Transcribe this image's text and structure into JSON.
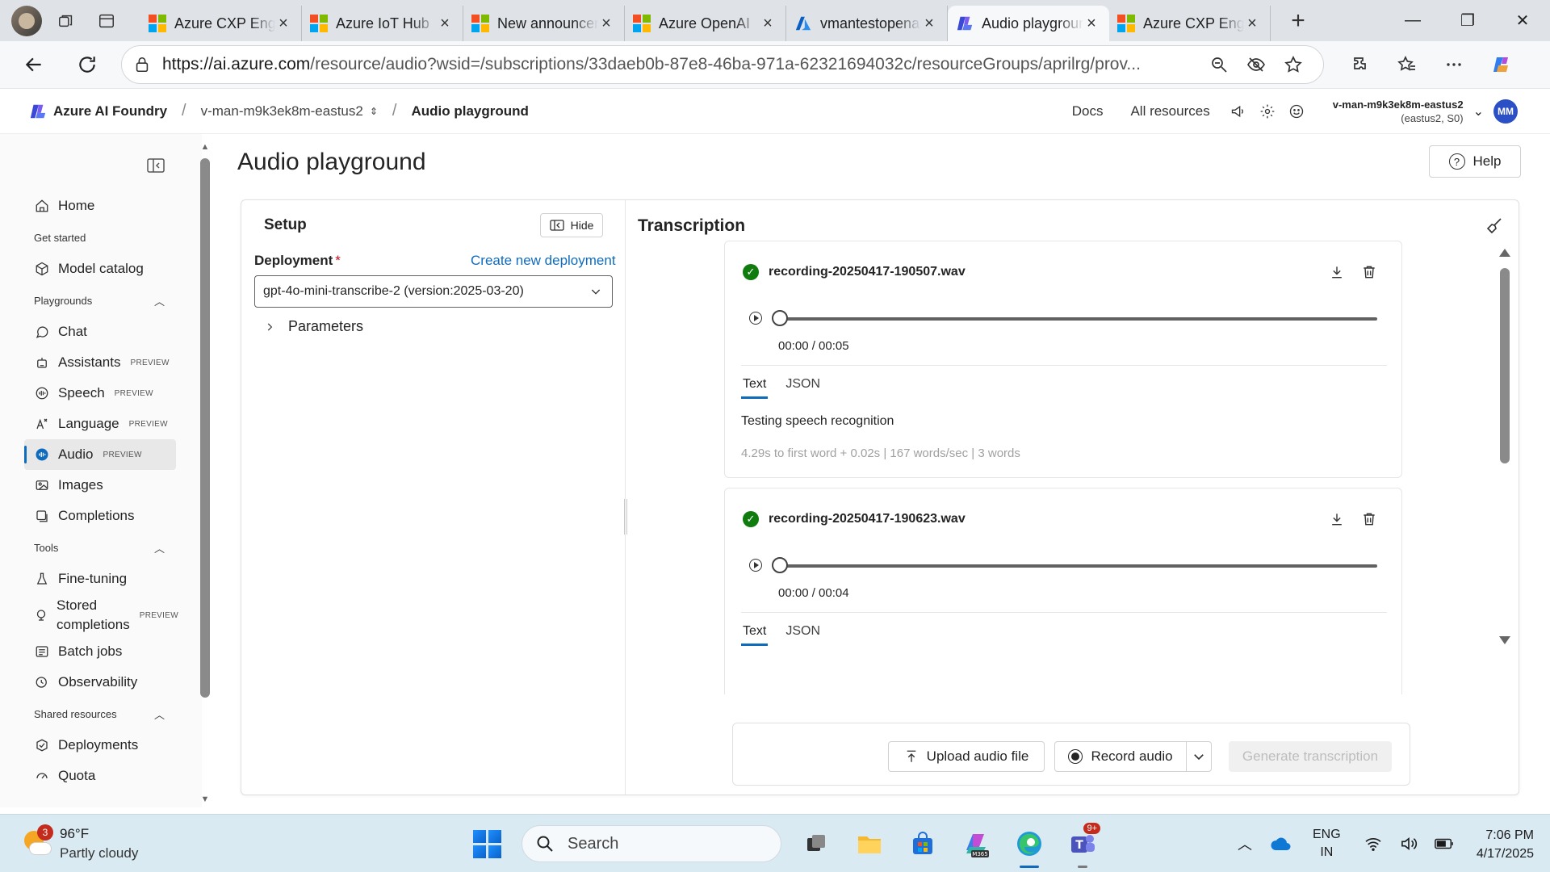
{
  "browser": {
    "tabs": [
      {
        "title": "Azure CXP Engagement",
        "favicon": "microsoft-logo"
      },
      {
        "title": "Azure IoT Hub",
        "favicon": "microsoft-logo"
      },
      {
        "title": "New announcement",
        "favicon": "microsoft-logo"
      },
      {
        "title": "Azure OpenAI",
        "favicon": "microsoft-logo"
      },
      {
        "title": "vmantestopenai",
        "favicon": "azure-logo"
      },
      {
        "title": "Audio playground",
        "favicon": "foundry-logo",
        "active": true
      },
      {
        "title": "Azure CXP Engagement",
        "favicon": "microsoft-logo"
      }
    ],
    "url_host": "https://ai.azure.com",
    "url_path": "/resource/audio?wsid=/subscriptions/33daeb0b-87e8-46ba-971a-62321694032c/resourceGroups/aprilrg/prov..."
  },
  "header": {
    "brand": "Azure AI Foundry",
    "project": "v-man-m9k3ek8m-eastus2",
    "page": "Audio playground",
    "docs": "Docs",
    "all_resources": "All resources",
    "account_name": "v-man-m9k3ek8m-eastus2",
    "account_sub": "(eastus2, S0)",
    "avatar": "MM"
  },
  "nav": {
    "home": "Home",
    "get_started": "Get started",
    "model_catalog": "Model catalog",
    "playgrounds": "Playgrounds",
    "chat": "Chat",
    "assistants": "Assistants",
    "speech": "Speech",
    "language": "Language",
    "audio": "Audio",
    "images": "Images",
    "completions": "Completions",
    "tools": "Tools",
    "fine_tuning": "Fine-tuning",
    "stored_completions": "Stored completions",
    "batch_jobs": "Batch jobs",
    "observability": "Observability",
    "shared_resources": "Shared resources",
    "deployments": "Deployments",
    "quota": "Quota",
    "preview": "PREVIEW"
  },
  "main": {
    "title": "Audio playground",
    "help": "Help",
    "setup": {
      "title": "Setup",
      "hide": "Hide",
      "deployment_label": "Deployment",
      "required_mark": "*",
      "create_link": "Create new deployment",
      "deployment_value": "gpt-4o-mini-transcribe-2 (version:2025-03-20)",
      "parameters": "Parameters"
    },
    "transcription": {
      "title": "Transcription",
      "tab_text": "Text",
      "tab_json": "JSON",
      "recordings": [
        {
          "file": "recording-20250417-190507.wav",
          "time": "00:00 / 00:05",
          "text": "Testing speech recognition",
          "stats": "4.29s to first word + 0.02s | 167 words/sec | 3 words"
        },
        {
          "file": "recording-20250417-190623.wav",
          "time": "00:00 / 00:04"
        }
      ]
    },
    "actions": {
      "upload": "Upload audio file",
      "record": "Record audio",
      "generate": "Generate transcription"
    }
  },
  "taskbar": {
    "weather_temp": "96°F",
    "weather_desc": "Partly cloudy",
    "weather_badge": "3",
    "search": "Search",
    "teams_badge": "9+",
    "lang1": "ENG",
    "lang2": "IN",
    "time": "7:06 PM",
    "date": "4/17/2025"
  }
}
